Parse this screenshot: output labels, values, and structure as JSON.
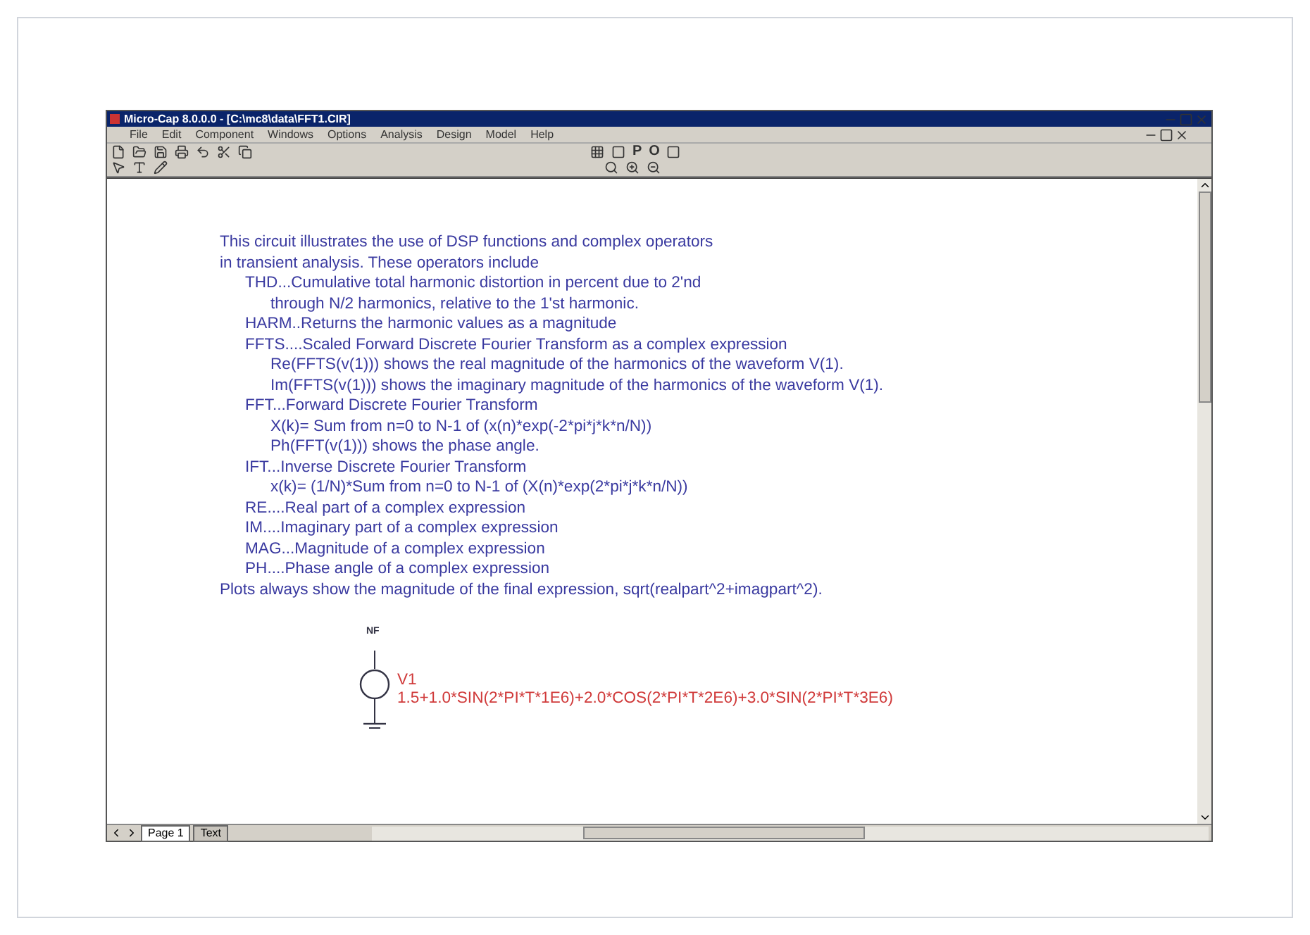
{
  "window": {
    "title": "Micro-Cap 8.0.0.0 - [C:\\mc8\\data\\FFT1.CIR]"
  },
  "menu": [
    "File",
    "Edit",
    "Component",
    "Windows",
    "Options",
    "Analysis",
    "Design",
    "Model",
    "Help"
  ],
  "toolbar_letters": [
    "P",
    "O"
  ],
  "notes": [
    {
      "text": "This circuit illustrates the use of DSP functions and complex operators"
    },
    {
      "text": "in transient analysis. These operators include",
      "children": [
        {
          "text": "THD...Cumulative total harmonic distortion in percent due to 2'nd",
          "children": [
            {
              "text": "through N/2 harmonics, relative to the 1'st harmonic."
            }
          ]
        },
        {
          "text": "HARM..Returns the harmonic values as a magnitude"
        },
        {
          "text": "FFTS....Scaled Forward Discrete Fourier Transform as a complex expression",
          "children": [
            {
              "text": "Re(FFTS(v(1))) shows the real magnitude of the harmonics of the waveform V(1)."
            },
            {
              "text": "Im(FFTS(v(1))) shows the imaginary magnitude of the harmonics of the waveform V(1)."
            }
          ]
        },
        {
          "text": "FFT...Forward Discrete Fourier Transform",
          "children": [
            {
              "text": "X(k)= Sum from n=0 to N-1 of (x(n)*exp(-2*pi*j*k*n/N))"
            },
            {
              "text": "Ph(FFT(v(1))) shows the phase angle."
            }
          ]
        },
        {
          "text": "IFT...Inverse Discrete Fourier Transform",
          "children": [
            {
              "text": "x(k)= (1/N)*Sum from n=0 to N-1 of (X(n)*exp(2*pi*j*k*n/N))"
            }
          ]
        },
        {
          "text": "RE....Real part of a complex expression"
        },
        {
          "text": "IM....Imaginary part of a complex expression"
        },
        {
          "text": "MAG...Magnitude of a complex expression"
        },
        {
          "text": "PH....Phase angle of a complex expression"
        }
      ]
    },
    {
      "text": "Plots always show the magnitude of the final expression, sqrt(realpart^2+imagpart^2)."
    }
  ],
  "source": {
    "symbol": "NF",
    "name": "V1",
    "value": "1.5+1.0*SIN(2*PI*T*1E6)+2.0*COS(2*PI*T*2E6)+3.0*SIN(2*PI*T*3E6)"
  },
  "page_tabs": [
    {
      "label": "Page 1",
      "selected": true
    },
    {
      "label": "Text",
      "selected": false
    }
  ]
}
